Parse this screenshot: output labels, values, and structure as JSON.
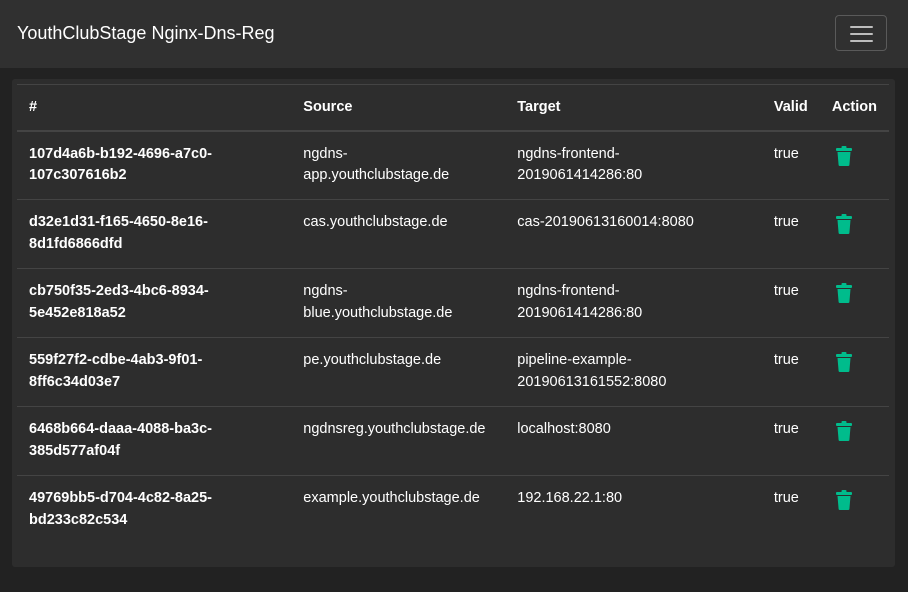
{
  "navbar": {
    "brand": "YouthClubStage Nginx-Dns-Reg",
    "toggler_icon": "hamburger-menu-icon"
  },
  "table": {
    "headers": {
      "id": "#",
      "source": "Source",
      "target": "Target",
      "valid": "Valid",
      "action": "Action"
    },
    "rows": [
      {
        "id_line1": "107d4a6b-b192-4696-a7c0-",
        "id_line2": "107c307616b2",
        "source_line1": "ngdns-",
        "source_line2": "app.youthclubstage.de",
        "target_line1": "ngdns-frontend-",
        "target_line2": "2019061414286:80",
        "valid": "true",
        "action_icon": "trash-icon"
      },
      {
        "id_line1": "d32e1d31-f165-4650-8e16-",
        "id_line2": "8d1fd6866dfd",
        "source_line1": "cas.youthclubstage.de",
        "source_line2": "",
        "target_line1": "cas-20190613160014:8080",
        "target_line2": "",
        "valid": "true",
        "action_icon": "trash-icon"
      },
      {
        "id_line1": "cb750f35-2ed3-4bc6-8934-",
        "id_line2": "5e452e818a52",
        "source_line1": "ngdns-",
        "source_line2": "blue.youthclubstage.de",
        "target_line1": "ngdns-frontend-",
        "target_line2": "2019061414286:80",
        "valid": "true",
        "action_icon": "trash-icon"
      },
      {
        "id_line1": "559f27f2-cdbe-4ab3-9f01-",
        "id_line2": "8ff6c34d03e7",
        "source_line1": "pe.youthclubstage.de",
        "source_line2": "",
        "target_line1": "pipeline-example-",
        "target_line2": "20190613161552:8080",
        "valid": "true",
        "action_icon": "trash-icon"
      },
      {
        "id_line1": "6468b664-daaa-4088-ba3c-",
        "id_line2": "385d577af04f",
        "source_line1": "ngdnsreg.youthclubstage.de",
        "source_line2": "",
        "target_line1": "localhost:8080",
        "target_line2": "",
        "valid": "true",
        "action_icon": "trash-icon"
      },
      {
        "id_line1": "49769bb5-d704-4c82-8a25-",
        "id_line2": "bd233c82c534",
        "source_line1": "example.youthclubstage.de",
        "source_line2": "",
        "target_line1": "192.168.22.1:80",
        "target_line2": "",
        "valid": "true",
        "action_icon": "trash-icon"
      }
    ]
  },
  "colors": {
    "page_background": "#222222",
    "navbar_background": "#303030",
    "card_background": "#2d2d2d",
    "row_divider": "#444444",
    "delete_icon": "#00bc8c",
    "text": "#ffffff"
  }
}
